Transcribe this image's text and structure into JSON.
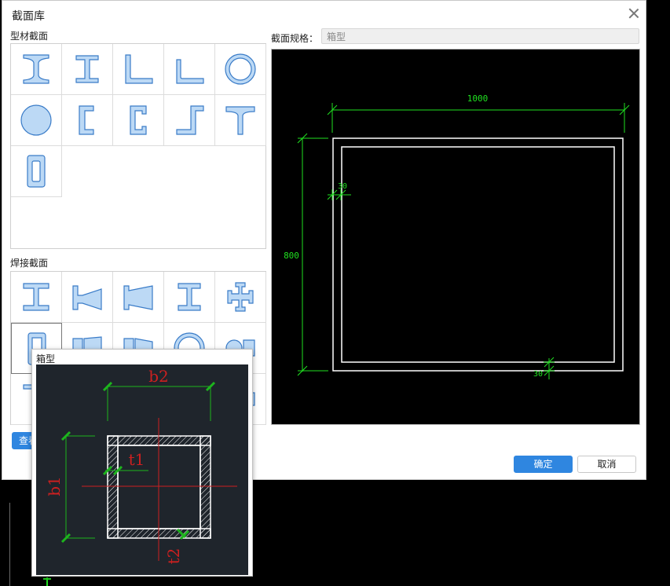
{
  "dialog": {
    "title": "截面库",
    "profile_section_label": "型材截面",
    "welded_section_label": "焊接截面",
    "spec_label": "截面规格：",
    "spec_value": "箱型",
    "ok_label": "确定",
    "cancel_label": "取消",
    "view_label": "查看"
  },
  "profile_icons": [
    "i-beam-icon",
    "h-beam-icon",
    "angle-icon",
    "unequal-angle-icon",
    "pipe-icon",
    "round-bar-icon",
    "channel-icon",
    "lipped-channel-icon",
    "z-section-icon",
    "tee-icon",
    "rect-tube-icon"
  ],
  "welded_icons": [
    "welded-i-icon",
    "welded-tapered-i-icon",
    "welded-tapered-h-icon",
    "welded-h-icon",
    "cross-section-icon",
    "welded-box-icon",
    "welded-box-tapered-icon",
    "welded-box-tapered-2-icon",
    "welded-pipe-icon",
    "welded-special-icon",
    "welded-tee-icon",
    "welded-misc-icon"
  ],
  "preview": {
    "width_dim": "1000",
    "height_dim": "800",
    "flange_dim": "30",
    "web_dim": "30"
  },
  "popup": {
    "title": "箱型",
    "b1": "b1",
    "b2": "b2",
    "t1": "t1",
    "t2": "t2"
  },
  "colors": {
    "accent": "#2f86e0",
    "dim_green": "#20e020",
    "cad_red": "#cc2020"
  }
}
